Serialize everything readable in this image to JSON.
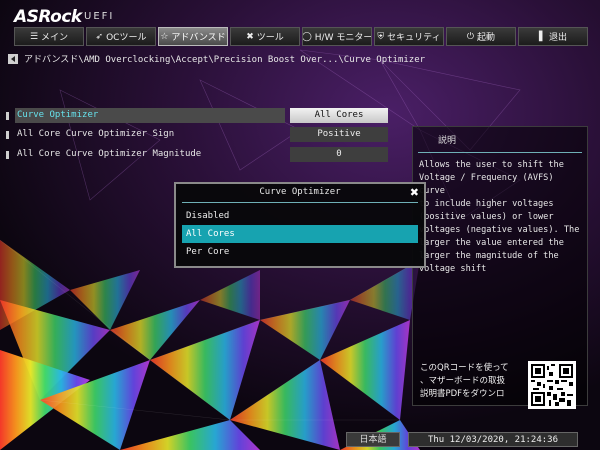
{
  "brand": {
    "logo": "ASRock",
    "sub": "UEFI"
  },
  "tabs": [
    {
      "label": "メイン",
      "icon": "list-icon",
      "glyph": "☰",
      "active": false
    },
    {
      "label": "OCツール",
      "icon": "rocket-icon",
      "glyph": "🚀",
      "active": false
    },
    {
      "label": "アドバンスド",
      "icon": "star-icon",
      "glyph": "☆",
      "active": true
    },
    {
      "label": "ツール",
      "icon": "tools-icon",
      "glyph": "✖",
      "active": false
    },
    {
      "label": "H/W モニター",
      "icon": "monitor-icon",
      "glyph": "◯",
      "active": false
    },
    {
      "label": "セキュリティ",
      "icon": "shield-icon",
      "glyph": "⛨",
      "active": false
    },
    {
      "label": "起動",
      "icon": "power-icon",
      "glyph": "⏻",
      "active": false
    },
    {
      "label": "退出",
      "icon": "exit-icon",
      "glyph": "▌",
      "active": false
    }
  ],
  "breadcrumb": "アドバンスド\\AMD Overclocking\\Accept\\Precision Boost Over...\\Curve Optimizer",
  "settings": [
    {
      "label": "Curve Optimizer",
      "value": "All Cores",
      "selected": true
    },
    {
      "label": "All Core Curve Optimizer Sign",
      "value": "Positive",
      "selected": false
    },
    {
      "label": "All Core Curve Optimizer Magnitude",
      "value": "0",
      "selected": false
    }
  ],
  "description": {
    "header": "説明",
    "text": "Allows the user to shift the\nVoltage / Frequency (AVFS) curve\nto include higher voltages\n(positive values) or lower\nvoltages (negative values). The\nlarger the value entered the\nlarger the magnitude of the\nvoltage shift"
  },
  "popup": {
    "title": "Curve Optimizer",
    "options": [
      "Disabled",
      "All Cores",
      "Per Core"
    ],
    "selected_index": 1
  },
  "qr_text": "このQRコードを使って\n、マザーボードの取扱\n説明書PDFをダウンロ",
  "footer": {
    "language": "日本語",
    "datetime": "Thu 12/03/2020, 21:24:36"
  },
  "colors": {
    "accent": "#17a3b0",
    "highlight_text": "#66e0ea"
  }
}
